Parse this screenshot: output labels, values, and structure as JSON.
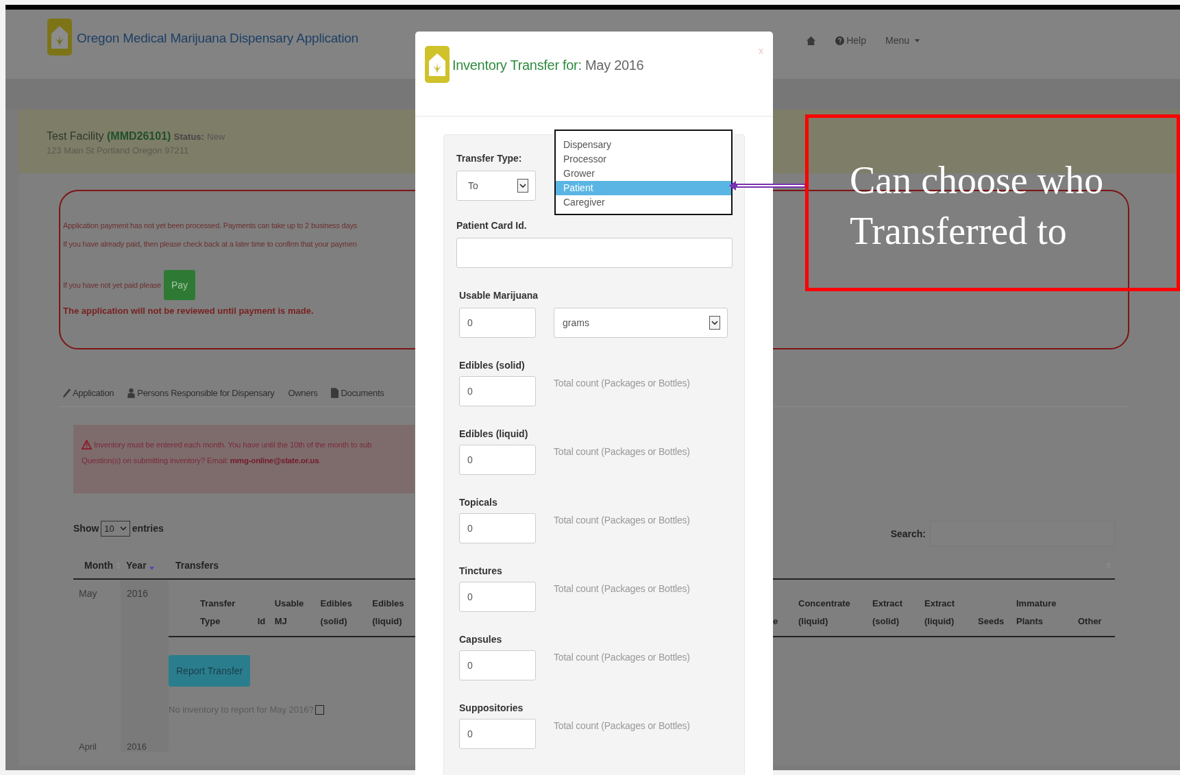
{
  "header": {
    "title": "Oregon Medical Marijuana Dispensary Application",
    "nav": [
      {
        "kind": "home"
      },
      {
        "kind": "help",
        "label": "Help"
      },
      {
        "kind": "menu",
        "label": "Menu"
      }
    ]
  },
  "facility": {
    "name": "Test Facility",
    "code": "(MMD26101)",
    "status_label": "Status:",
    "status": "New",
    "address": "123 Main St Portland Oregon 97211"
  },
  "payment_alert": {
    "lines": [
      "Application payment has not yet been processed. Payments can take up to 2 business days",
      "If you have already paid, then please check back at a later time to confirm that your paymen"
    ],
    "pay_prompt": "If you have not yet paid please",
    "pay_button": "Pay",
    "warning": "The application will not be reviewed until payment is made."
  },
  "tabs": [
    {
      "kind": "edit",
      "label": "Application"
    },
    {
      "kind": "person",
      "label": "Persons Responsible for Dispensary"
    },
    {
      "kind": "plain",
      "label": "Owners"
    },
    {
      "kind": "document",
      "label": "Documents"
    }
  ],
  "inventory_alert": {
    "line": "Inventory must be entered each month. You have until the 10th of the month to sub",
    "question": "Question(s) on submitting inventory? Email:",
    "email": "mmg-online@state.or.us",
    "end": "."
  },
  "entries": {
    "show": "Show",
    "value": "10",
    "suffix": "entries"
  },
  "search": {
    "label": "Search:"
  },
  "table": {
    "columns": [
      {
        "label": "Month",
        "sorted": false
      },
      {
        "label": "Year",
        "sorted": true
      },
      {
        "label": "Transfers",
        "sorted": false
      }
    ],
    "rows": [
      {
        "month": "May",
        "year": "2016",
        "transfer_columns_left": [
          "Transfer Type",
          "Id",
          "Usable MJ",
          "Edibles (solid)",
          "Edibles (liquid)"
        ],
        "transfer_columns_right": [
          "e",
          "Concentrate (liquid)",
          "Extract (solid)",
          "Extract (liquid)",
          "Seeds",
          "Immature Plants",
          "Other"
        ],
        "button": "Report Transfer",
        "no_inventory": {
          "label": "No inventory to report for May 2016?",
          "checked": false
        }
      },
      {
        "month": "April",
        "year": "2016"
      }
    ]
  },
  "modal": {
    "title": "Inventory Transfer for:",
    "period": "May 2016",
    "close": "x",
    "transfer_type": {
      "label": "Transfer Type:",
      "value": "To",
      "options": [
        {
          "label": "Dispensary",
          "selected": false
        },
        {
          "label": "Processor",
          "selected": false
        },
        {
          "label": "Grower",
          "selected": false
        },
        {
          "label": "Patient",
          "selected": true
        },
        {
          "label": "Caregiver",
          "selected": false
        }
      ]
    },
    "card_id": {
      "label": "Patient Card Id."
    },
    "usable": {
      "label": "Usable Marijuana",
      "value": "0",
      "unit": "grams"
    },
    "counts": [
      {
        "label": "Edibles (solid)",
        "value": "0",
        "hint": "Total count (Packages or Bottles)"
      },
      {
        "label": "Edibles (liquid)",
        "value": "0",
        "hint": "Total count (Packages or Bottles)"
      },
      {
        "label": "Topicals",
        "value": "0",
        "hint": "Total count (Packages or Bottles)"
      },
      {
        "label": "Tinctures",
        "value": "0",
        "hint": "Total count (Packages or Bottles)"
      },
      {
        "label": "Capsules",
        "value": "0",
        "hint": "Total count (Packages or Bottles)"
      },
      {
        "label": "Suppositories",
        "value": "0",
        "hint": "Total count (Packages or Bottles)"
      }
    ]
  },
  "annotation": {
    "text": "Can choose who Transferred to"
  }
}
